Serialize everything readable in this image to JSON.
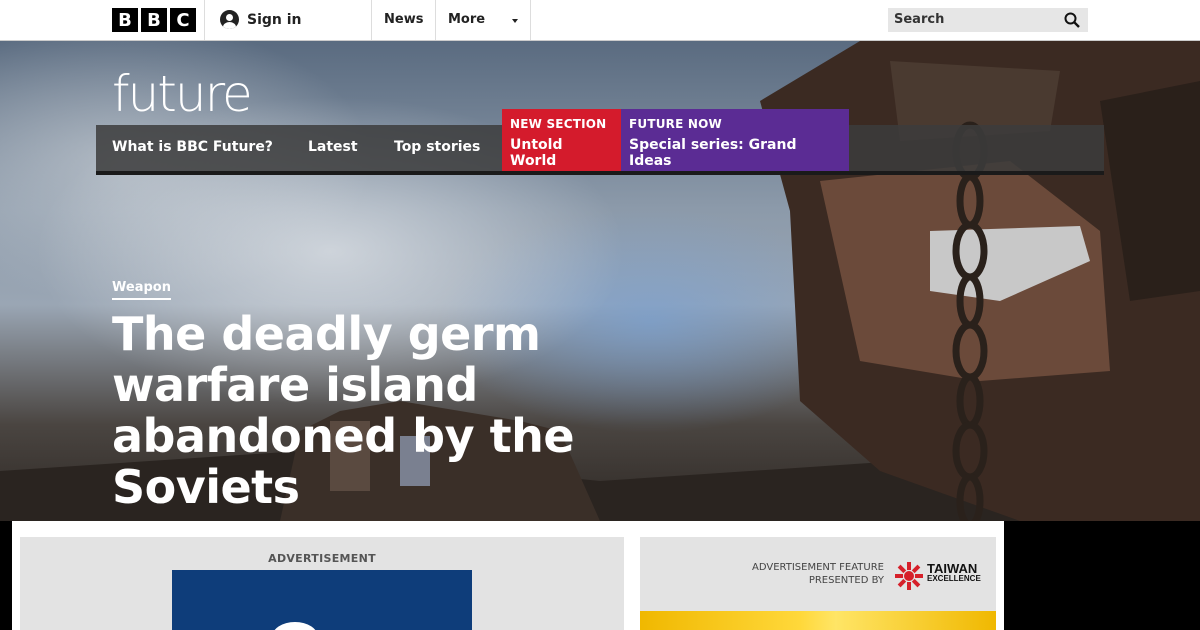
{
  "header": {
    "logo_letters": [
      "B",
      "B",
      "C"
    ],
    "sign_in_label": "Sign in",
    "nav": [
      "News",
      "More"
    ],
    "search_placeholder": "Search"
  },
  "site": {
    "logo_text": "future",
    "nav_links": [
      "What is BBC Future?",
      "Latest",
      "Top stories"
    ],
    "promos": [
      {
        "kicker": "NEW SECTION",
        "title": "Untold World",
        "color": "#d41b2c"
      },
      {
        "kicker": "FUTURE NOW",
        "title": "Special series: Grand Ideas",
        "color": "#5b2c94"
      }
    ]
  },
  "hero": {
    "category": "Weapon",
    "headline": "The deadly germ warfare island abandoned by the Soviets"
  },
  "ads": {
    "left_label": "ADVERTISEMENT",
    "feature_label_line1": "ADVERTISEMENT FEATURE",
    "feature_label_line2": "PRESENTED BY",
    "sponsor_line1": "TAIWAN",
    "sponsor_line2": "EXCELLENCE"
  },
  "colors": {
    "accent_red": "#d41b2c",
    "accent_purple": "#5b2c94",
    "ad_blue": "#0e3d7a"
  }
}
